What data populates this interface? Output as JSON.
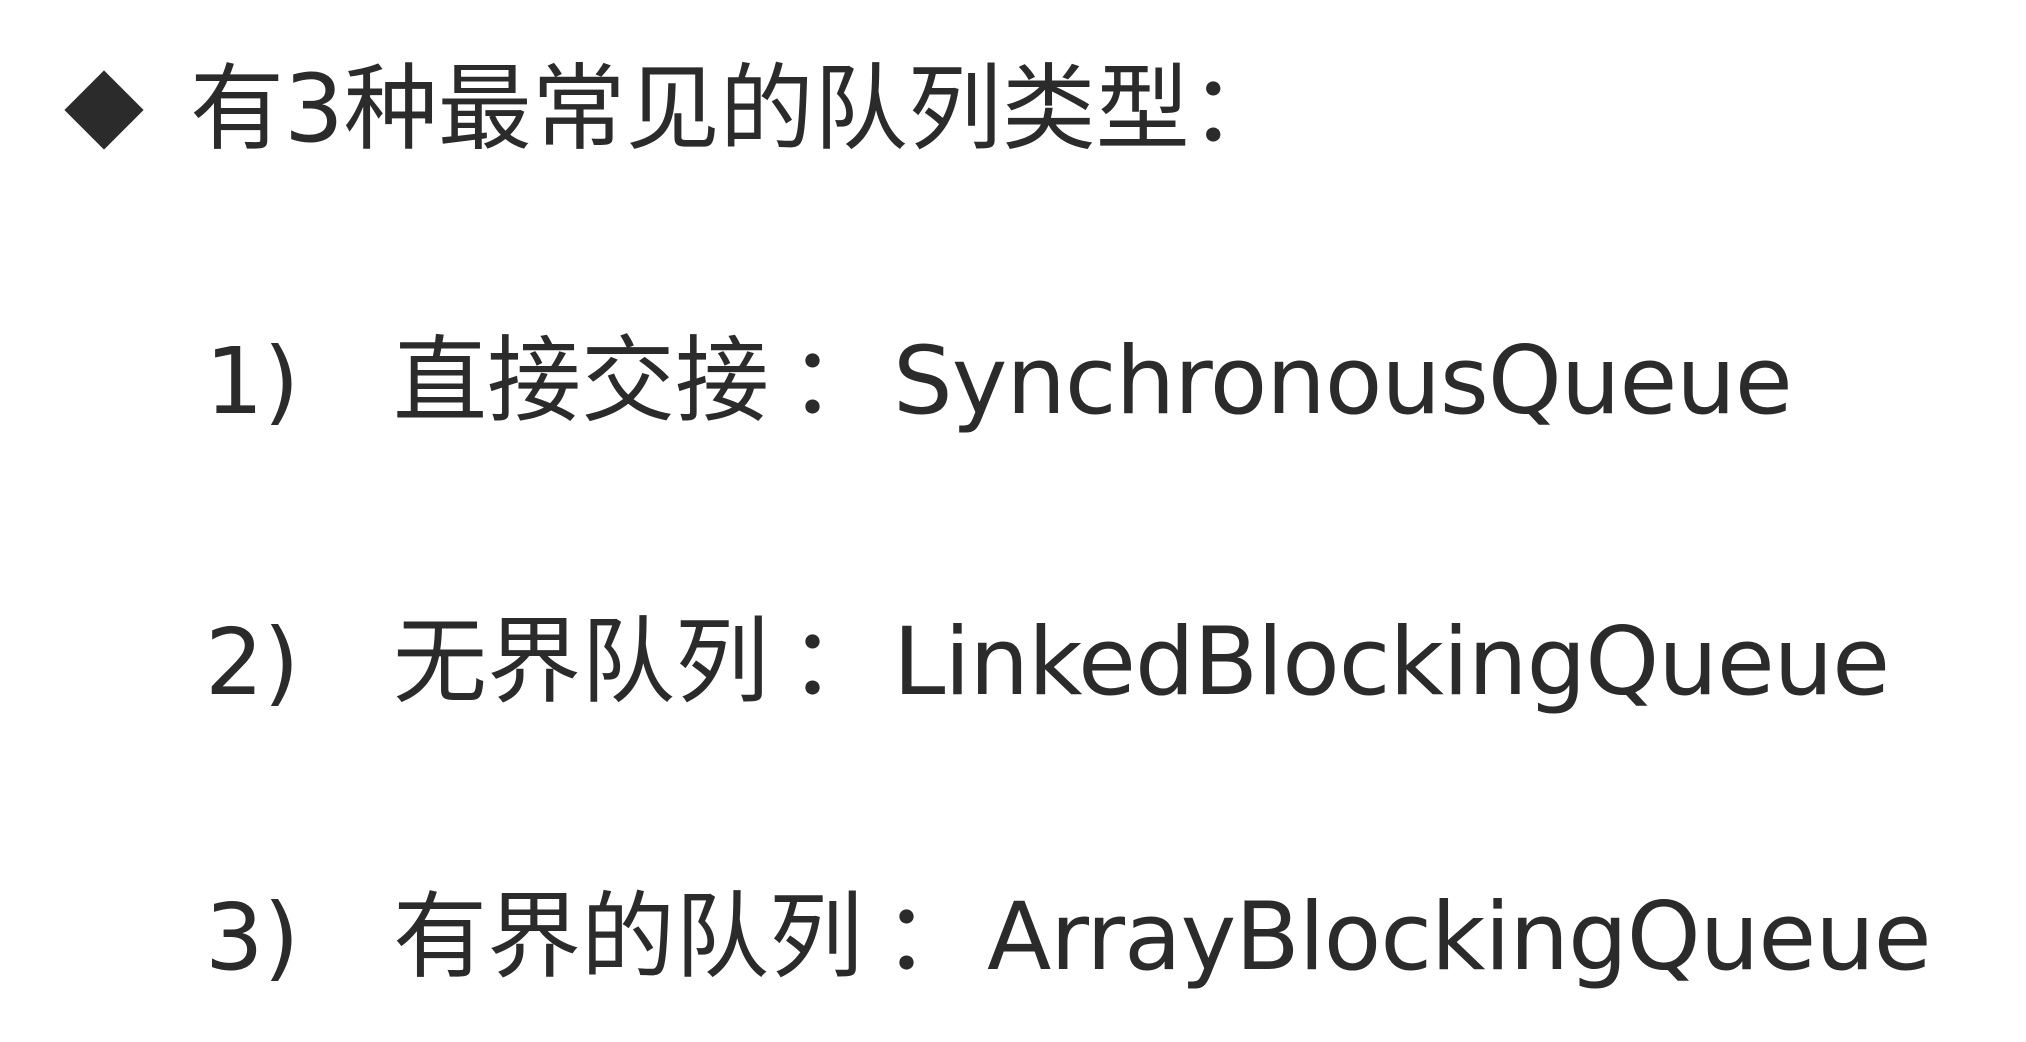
{
  "heading": {
    "text": "有3种最常见的队列类型："
  },
  "items": [
    {
      "number": "1)",
      "label": "直接交接",
      "separator": "：",
      "class_name": "SynchronousQueue"
    },
    {
      "number": "2)",
      "label": "无界队列",
      "separator": "：",
      "class_name": "LinkedBlockingQueue"
    },
    {
      "number": "3)",
      "label": "有界的队列",
      "separator": "：",
      "class_name": "ArrayBlockingQueue"
    }
  ]
}
